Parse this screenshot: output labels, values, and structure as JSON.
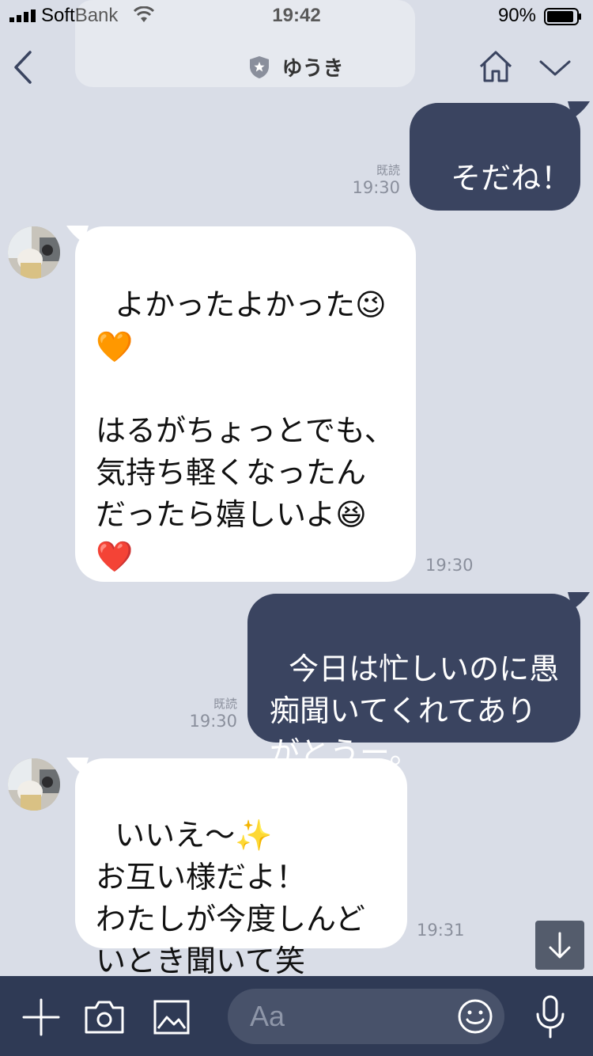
{
  "status_bar": {
    "carrier": "SoftBank",
    "time": "19:42",
    "battery": "90%"
  },
  "header": {
    "title": "ゆうき"
  },
  "messages": [
    {
      "side": "sent",
      "text": "そだね！",
      "read": "既読",
      "time": "19:30"
    },
    {
      "side": "recv",
      "text": "よかったよかった😉\n🧡\n\nはるがちょっとでも、\n気持ち軽くなったんだったら嬉しいよ😆\n❤️",
      "time": "19:30"
    },
    {
      "side": "sent",
      "text": "今日は忙しいのに愚痴聞いてくれてありがとうー。",
      "read": "既読",
      "time": "19:30"
    },
    {
      "side": "recv",
      "text": "いいえ〜✨\nお互い様だよ！\nわたしが今度しんどいとき聞いて笑",
      "time": "19:31"
    }
  ],
  "input_bar": {
    "placeholder": "Aa"
  },
  "colors": {
    "background": "#d9dde7",
    "sent_bubble": "#3a4460",
    "recv_bubble": "#ffffff",
    "input_bar": "#2f3a55"
  }
}
